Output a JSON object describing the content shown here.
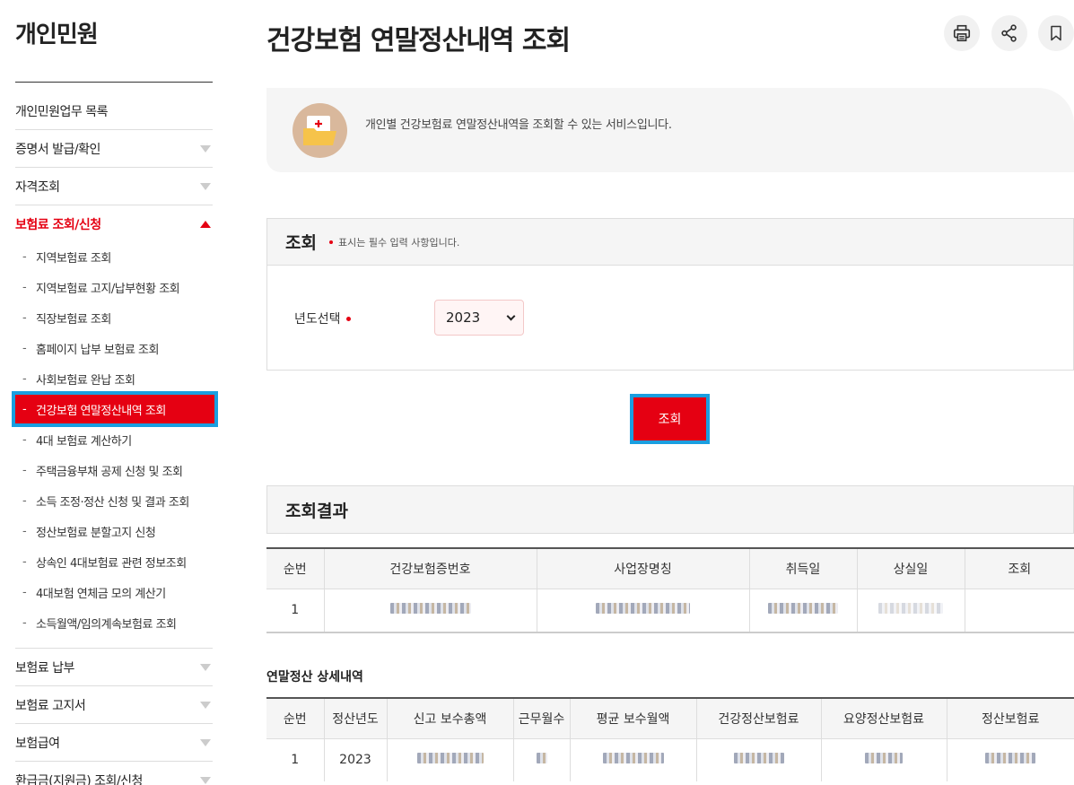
{
  "sidebar": {
    "title": "개인민원",
    "top_items": [
      "개인민원업무 목록",
      "증명서 발급/확인",
      "자격조회"
    ],
    "active_item": "보험료 조회/신청",
    "sub_items": [
      "지역보험료 조회",
      "지역보험료 고지/납부현황 조회",
      "직장보험료 조회",
      "홈페이지 납부 보험료 조회",
      "사회보험료 완납 조회",
      "건강보험 연말정산내역 조회",
      "4대 보험료 계산하기",
      "주택금융부채 공제 신청 및 조회",
      "소득 조정·정산 신청 및 결과 조회",
      "정산보험료 분할고지 신청",
      "상속인 4대보험료 관련 정보조회",
      "4대보험 연체금 모의 계산기",
      "소득월액/임의계속보험료 조회"
    ],
    "bottom_items": [
      "보험료 납부",
      "보험료 고지서",
      "보험급여",
      "환급금(지원금) 조회/신청"
    ]
  },
  "header": {
    "title": "건강보험 연말정산내역 조회",
    "icons": [
      "print-icon",
      "share-icon",
      "bookmark-icon"
    ]
  },
  "info": {
    "text": "개인별 건강보험료 연말정산내역을 조회할 수 있는 서비스입니다."
  },
  "search": {
    "title": "조회",
    "required_note": "표시는 필수 입력 사항입니다.",
    "year_label": "년도선택",
    "year_value": "2023",
    "button": "조회"
  },
  "results": {
    "title": "조회결과",
    "columns": [
      "순번",
      "건강보험증번호",
      "사업장명칭",
      "취득일",
      "상실일",
      "조회"
    ],
    "rows": [
      {
        "no": "1"
      }
    ]
  },
  "detail": {
    "title": "연말정산 상세내역",
    "columns": [
      "순번",
      "정산년도",
      "신고 보수총액",
      "근무월수",
      "평균 보수월액",
      "건강정산보험료",
      "요양정산보험료",
      "정산보험료"
    ],
    "rows": [
      {
        "no": "1",
        "year": "2023"
      }
    ]
  },
  "colors": {
    "accent": "#e50012",
    "highlight": "#1a9fe0"
  }
}
